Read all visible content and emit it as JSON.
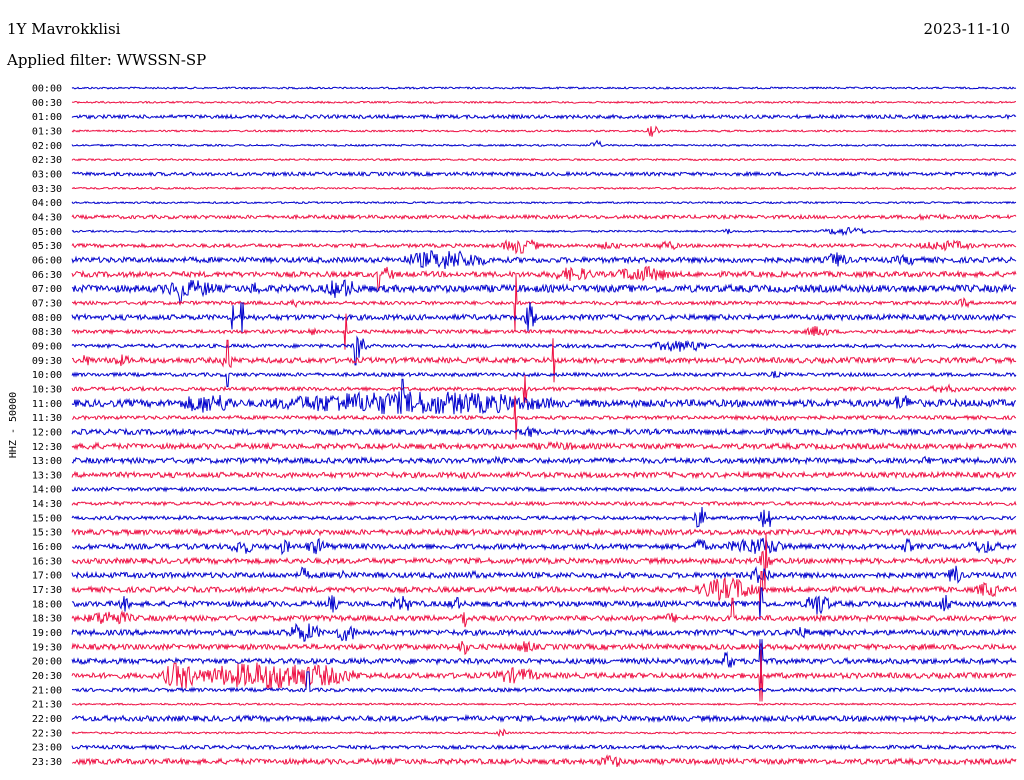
{
  "header": {
    "station": "1Y Mavrokklisi",
    "date": "2023-11-10",
    "filter": "Applied filter: WWSSN-SP"
  },
  "chart_data": {
    "type": "line",
    "ylabel": "HHZ - 50000",
    "tick_labels": [
      "00:00",
      "00:30",
      "01:00",
      "01:30",
      "02:00",
      "02:30",
      "03:00",
      "03:30",
      "04:00",
      "04:30",
      "05:00",
      "05:30",
      "06:00",
      "06:30",
      "07:00",
      "07:30",
      "08:00",
      "08:30",
      "09:00",
      "09:30",
      "10:00",
      "10:30",
      "11:00",
      "11:30",
      "12:00",
      "12:30",
      "13:00",
      "13:30",
      "14:00",
      "14:30",
      "15:00",
      "15:30",
      "16:00",
      "16:30",
      "17:00",
      "17:30",
      "18:00",
      "18:30",
      "19:00",
      "19:30",
      "20:00",
      "20:30",
      "21:00",
      "21:30",
      "22:00",
      "22:30",
      "23:00",
      "23:30"
    ],
    "colors": {
      "even": "#0000cc",
      "odd": "#ee1144"
    },
    "trace_baseline": [
      1,
      1,
      2,
      1,
      1,
      1,
      2,
      1,
      1,
      2,
      1,
      2,
      3,
      3,
      4,
      2,
      3,
      2,
      2,
      3,
      2,
      2,
      4,
      2,
      3,
      3,
      3,
      3,
      2,
      2,
      2,
      3,
      3,
      3,
      3,
      3,
      3,
      3,
      3,
      3,
      3,
      3,
      2,
      1,
      3,
      1,
      2,
      3
    ],
    "events": [
      {
        "row": 3,
        "x": [
          0.61,
          0.62
        ],
        "amp": 6
      },
      {
        "row": 4,
        "x": [
          0.55,
          0.56
        ],
        "amp": 5
      },
      {
        "row": 6,
        "x": [
          0.2,
          0.22
        ],
        "amp": 2
      },
      {
        "row": 9,
        "x": [
          0.89,
          0.93
        ],
        "amp": 3
      },
      {
        "row": 10,
        "x": [
          0.69,
          0.7
        ],
        "amp": 3
      },
      {
        "row": 10,
        "x": [
          0.8,
          0.84
        ],
        "amp": 4
      },
      {
        "row": 11,
        "x": [
          0.46,
          0.49
        ],
        "amp": 8
      },
      {
        "row": 11,
        "x": [
          0.56,
          0.58
        ],
        "amp": 4
      },
      {
        "row": 11,
        "x": [
          0.62,
          0.64
        ],
        "amp": 5
      },
      {
        "row": 11,
        "x": [
          0.9,
          0.95
        ],
        "amp": 5
      },
      {
        "row": 12,
        "x": [
          0.36,
          0.43
        ],
        "amp": 10
      },
      {
        "row": 12,
        "x": [
          0.8,
          0.82
        ],
        "amp": 8
      },
      {
        "row": 12,
        "x": [
          0.87,
          0.9
        ],
        "amp": 5
      },
      {
        "row": 13,
        "x": [
          0.33,
          0.34
        ],
        "amp": 8
      },
      {
        "row": 13,
        "x": [
          0.51,
          0.55
        ],
        "amp": 7
      },
      {
        "row": 13,
        "x": [
          0.58,
          0.63
        ],
        "amp": 8
      },
      {
        "row": 14,
        "x": [
          0.1,
          0.15
        ],
        "amp": 9
      },
      {
        "row": 14,
        "x": [
          0.19,
          0.2
        ],
        "amp": 8
      },
      {
        "row": 14,
        "x": [
          0.27,
          0.3
        ],
        "amp": 10
      },
      {
        "row": 15,
        "x": [
          0.23,
          0.24
        ],
        "amp": 5
      },
      {
        "row": 15,
        "x": [
          0.94,
          0.95
        ],
        "amp": 5
      },
      {
        "row": 16,
        "x": [
          0.48,
          0.49
        ],
        "amp": 16
      },
      {
        "row": 17,
        "x": [
          0.25,
          0.26
        ],
        "amp": 4
      },
      {
        "row": 17,
        "x": [
          0.78,
          0.8
        ],
        "amp": 6
      },
      {
        "row": 18,
        "x": [
          0.3,
          0.31
        ],
        "amp": 12
      },
      {
        "row": 18,
        "x": [
          0.62,
          0.67
        ],
        "amp": 6
      },
      {
        "row": 19,
        "x": [
          0.01,
          0.02
        ],
        "amp": 6
      },
      {
        "row": 19,
        "x": [
          0.04,
          0.06
        ],
        "amp": 6
      },
      {
        "row": 19,
        "x": [
          0.16,
          0.17
        ],
        "amp": 10
      },
      {
        "row": 20,
        "x": [
          0.74,
          0.75
        ],
        "amp": 4
      },
      {
        "row": 21,
        "x": [
          0.91,
          0.94
        ],
        "amp": 4
      },
      {
        "row": 22,
        "x": [
          0.12,
          0.17
        ],
        "amp": 10
      },
      {
        "row": 22,
        "x": [
          0.24,
          0.48
        ],
        "amp": 12
      },
      {
        "row": 22,
        "x": [
          0.87,
          0.89
        ],
        "amp": 9
      },
      {
        "row": 23,
        "x": [
          0.72,
          0.78
        ],
        "amp": 3
      },
      {
        "row": 24,
        "x": [
          0.48,
          0.49
        ],
        "amp": 7
      },
      {
        "row": 24,
        "x": [
          0.61,
          0.63
        ],
        "amp": 3
      },
      {
        "row": 25,
        "x": [
          0.01,
          0.03
        ],
        "amp": 4
      },
      {
        "row": 25,
        "x": [
          0.48,
          0.55
        ],
        "amp": 4
      },
      {
        "row": 26,
        "x": [
          0.27,
          0.33
        ],
        "amp": 3
      },
      {
        "row": 26,
        "x": [
          0.44,
          0.46
        ],
        "amp": 5
      },
      {
        "row": 26,
        "x": [
          0.9,
          0.91
        ],
        "amp": 5
      },
      {
        "row": 27,
        "x": [
          0.41,
          0.42
        ],
        "amp": 4
      },
      {
        "row": 30,
        "x": [
          0.66,
          0.67
        ],
        "amp": 12
      },
      {
        "row": 30,
        "x": [
          0.73,
          0.74
        ],
        "amp": 16
      },
      {
        "row": 32,
        "x": [
          0.17,
          0.19
        ],
        "amp": 8
      },
      {
        "row": 32,
        "x": [
          0.22,
          0.23
        ],
        "amp": 8
      },
      {
        "row": 32,
        "x": [
          0.25,
          0.27
        ],
        "amp": 8
      },
      {
        "row": 32,
        "x": [
          0.66,
          0.67
        ],
        "amp": 10
      },
      {
        "row": 32,
        "x": [
          0.7,
          0.75
        ],
        "amp": 9
      },
      {
        "row": 32,
        "x": [
          0.88,
          0.89
        ],
        "amp": 8
      },
      {
        "row": 32,
        "x": [
          0.95,
          0.98
        ],
        "amp": 7
      },
      {
        "row": 33,
        "x": [
          0.73,
          0.74
        ],
        "amp": 12
      },
      {
        "row": 34,
        "x": [
          0.24,
          0.25
        ],
        "amp": 8
      },
      {
        "row": 34,
        "x": [
          0.28,
          0.29
        ],
        "amp": 7
      },
      {
        "row": 34,
        "x": [
          0.42,
          0.43
        ],
        "amp": 5
      },
      {
        "row": 34,
        "x": [
          0.72,
          0.74
        ],
        "amp": 9
      },
      {
        "row": 34,
        "x": [
          0.93,
          0.94
        ],
        "amp": 12
      },
      {
        "row": 35,
        "x": [
          0.67,
          0.72
        ],
        "amp": 12
      },
      {
        "row": 35,
        "x": [
          0.96,
          0.98
        ],
        "amp": 8
      },
      {
        "row": 36,
        "x": [
          0.05,
          0.06
        ],
        "amp": 8
      },
      {
        "row": 36,
        "x": [
          0.27,
          0.28
        ],
        "amp": 9
      },
      {
        "row": 36,
        "x": [
          0.34,
          0.36
        ],
        "amp": 8
      },
      {
        "row": 36,
        "x": [
          0.4,
          0.41
        ],
        "amp": 9
      },
      {
        "row": 36,
        "x": [
          0.78,
          0.8
        ],
        "amp": 12
      },
      {
        "row": 36,
        "x": [
          0.92,
          0.93
        ],
        "amp": 10
      },
      {
        "row": 37,
        "x": [
          0.02,
          0.06
        ],
        "amp": 8
      },
      {
        "row": 37,
        "x": [
          0.41,
          0.42
        ],
        "amp": 10
      },
      {
        "row": 37,
        "x": [
          0.63,
          0.64
        ],
        "amp": 6
      },
      {
        "row": 38,
        "x": [
          0.23,
          0.26
        ],
        "amp": 10
      },
      {
        "row": 38,
        "x": [
          0.28,
          0.3
        ],
        "amp": 9
      },
      {
        "row": 38,
        "x": [
          0.76,
          0.78
        ],
        "amp": 6
      },
      {
        "row": 39,
        "x": [
          0.41,
          0.42
        ],
        "amp": 8
      },
      {
        "row": 39,
        "x": [
          0.47,
          0.49
        ],
        "amp": 6
      },
      {
        "row": 40,
        "x": [
          0.69,
          0.7
        ],
        "amp": 11
      },
      {
        "row": 41,
        "x": [
          0.1,
          0.13
        ],
        "amp": 14
      },
      {
        "row": 41,
        "x": [
          0.15,
          0.28
        ],
        "amp": 14
      },
      {
        "row": 41,
        "x": [
          0.22,
          0.26
        ],
        "amp": 12
      },
      {
        "row": 41,
        "x": [
          0.45,
          0.49
        ],
        "amp": 8
      },
      {
        "row": 45,
        "x": [
          0.45,
          0.46
        ],
        "amp": 4
      },
      {
        "row": 47,
        "x": [
          0.56,
          0.58
        ],
        "amp": 7
      }
    ],
    "spikes": [
      {
        "row": 13,
        "x": 0.325,
        "amp": 16
      },
      {
        "row": 14,
        "x": 0.115,
        "amp": 14
      },
      {
        "row": 15,
        "x": 0.47,
        "amp": 28
      },
      {
        "row": 16,
        "x": 0.17,
        "amp": 12
      },
      {
        "row": 16,
        "x": 0.18,
        "amp": 15
      },
      {
        "row": 17,
        "x": 0.29,
        "amp": 18
      },
      {
        "row": 18,
        "x": 0.3,
        "amp": 19
      },
      {
        "row": 19,
        "x": 0.51,
        "amp": 22
      },
      {
        "row": 19,
        "x": 0.165,
        "amp": 20
      },
      {
        "row": 20,
        "x": 0.165,
        "amp": 12
      },
      {
        "row": 21,
        "x": 0.48,
        "amp": 14
      },
      {
        "row": 22,
        "x": 0.35,
        "amp": 24
      },
      {
        "row": 23,
        "x": 0.47,
        "amp": 22
      },
      {
        "row": 33,
        "x": 0.735,
        "amp": 28
      },
      {
        "row": 35,
        "x": 0.73,
        "amp": 18
      },
      {
        "row": 36,
        "x": 0.73,
        "amp": 16
      },
      {
        "row": 37,
        "x": 0.7,
        "amp": 20
      },
      {
        "row": 40,
        "x": 0.73,
        "amp": 22
      },
      {
        "row": 41,
        "x": 0.73,
        "amp": 26
      },
      {
        "row": 42,
        "x": 0.25,
        "amp": 18
      }
    ]
  }
}
